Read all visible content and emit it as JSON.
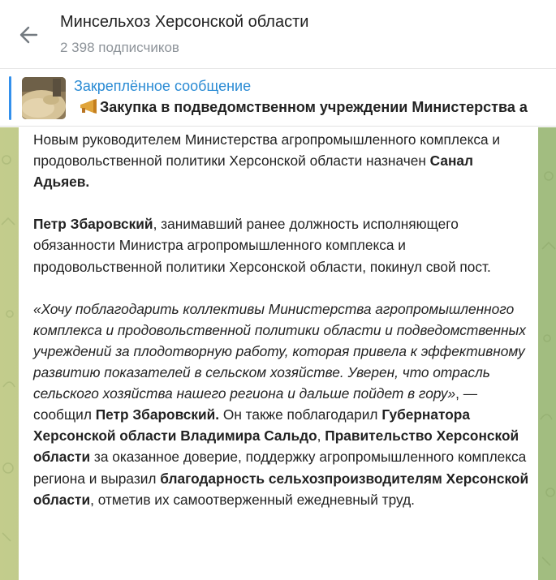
{
  "header": {
    "title": "Минсельхоз Херсонской области",
    "subscribers": "2 398 подписчиков"
  },
  "pinned": {
    "label": "Закреплённое сообщение",
    "text": "Закупка в подведомственном учреждении Министерства а"
  },
  "message": {
    "p1": {
      "t1": "Новым руководителем Министерства агропромышленного комплекса и продовольственной политики Херсонской области назначен ",
      "b1": "Санал Адьяев."
    },
    "p2": {
      "b1": "Петр Збаровский",
      "t1": ", занимавший ранее должность исполняющего обязанности Министра агропромышленного комплекса и продовольственной политики Херсонской области, покинул свой пост."
    },
    "p3": {
      "quote": "«Хочу поблагодарить коллективы Министерства агропромышленного комплекса и продовольственной политики области и подведомственных учреждений за плодотворную работу, которая привела к эффективному развитию показателей в сельском хозяйстве. Уверен, что отрасль сельского хозяйства нашего региона и дальше пойдет в гору»",
      "t1": ", — сообщил ",
      "b1": "Петр Збаровский.",
      "t2": " Он также поблагодарил ",
      "b2": "Губернатора Херсонской области Владимира Сальдо",
      "t3": ", ",
      "b3": "Правительство Херсонской области",
      "t4": " за оказанное доверие, поддержку агропромышленного комплекса региона и выразил ",
      "b4": "благодарность сельхозпроизводителям Херсонской области",
      "t5": ", отметив их самоотверженный ежедневный труд."
    }
  }
}
